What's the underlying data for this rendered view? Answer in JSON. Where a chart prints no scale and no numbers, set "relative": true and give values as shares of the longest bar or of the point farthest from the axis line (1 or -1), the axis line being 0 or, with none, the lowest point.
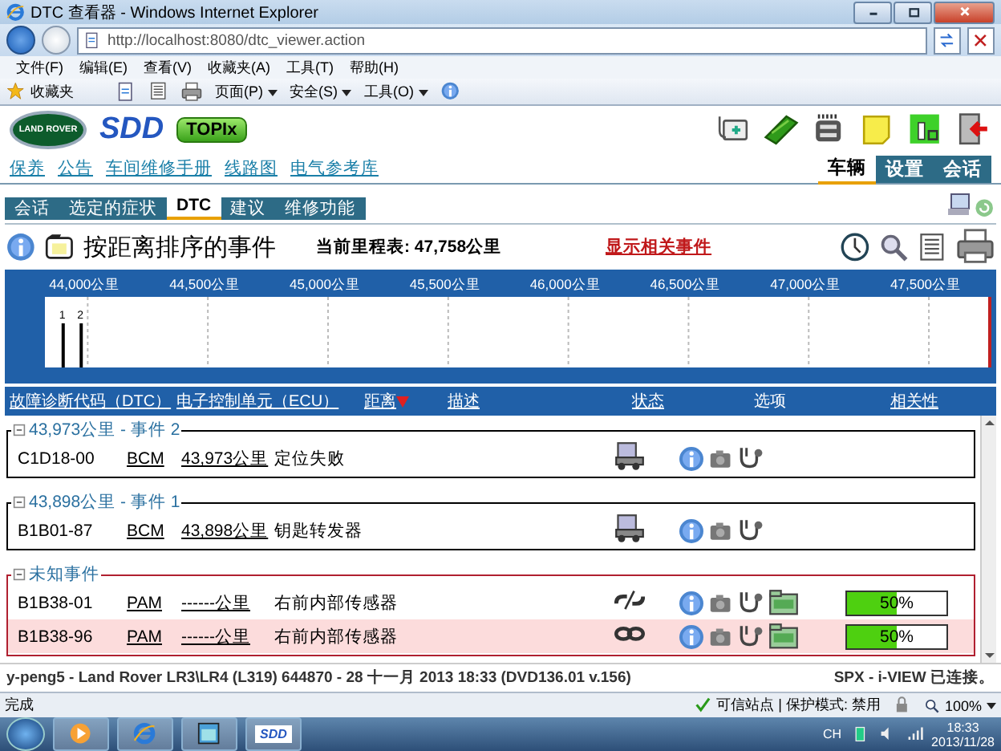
{
  "browser": {
    "title": "DTC 查看器 - Windows Internet Explorer",
    "address": "http://localhost:8080/dtc_viewer.action",
    "menu": [
      "文件(F)",
      "编辑(E)",
      "查看(V)",
      "收藏夹(A)",
      "工具(T)",
      "帮助(H)"
    ],
    "favorites": "收藏夹",
    "commands": [
      "页面(P)",
      "安全(S)",
      "工具(O)"
    ]
  },
  "header": {
    "logo": "LAND ROVER",
    "product": "SDD",
    "topix": "TOPIx",
    "links": [
      "保养",
      "公告",
      "车间维修手册",
      "线路图",
      "电气参考库"
    ],
    "top_tabs": [
      {
        "label": "车辆",
        "selected": true
      },
      {
        "label": "设置",
        "selected": false
      },
      {
        "label": "会话",
        "selected": false
      }
    ]
  },
  "tabs": [
    {
      "label": "会话",
      "selected": false
    },
    {
      "label": "选定的症状",
      "selected": false
    },
    {
      "label": "DTC",
      "selected": true
    },
    {
      "label": "建议",
      "selected": false
    },
    {
      "label": "维修功能",
      "selected": false
    }
  ],
  "title": "按距离排序的事件",
  "odometer_label": "当前里程表:",
  "odometer": "47,758公里",
  "related_link": "显示相关事件",
  "timeline": {
    "event_labels": [
      "1",
      "2"
    ],
    "chart_data": {
      "type": "bar",
      "x": [
        43898,
        43973
      ],
      "values": [
        1,
        1
      ],
      "relative": true,
      "grid": true,
      "xlim": [
        43822,
        47760
      ],
      "xticks": [
        {
          "value": 44000,
          "label": "44,000公里"
        },
        {
          "value": 44500,
          "label": "44,500公里"
        },
        {
          "value": 45000,
          "label": "45,000公里"
        },
        {
          "value": 45500,
          "label": "45,500公里"
        },
        {
          "value": 46000,
          "label": "46,000公里"
        },
        {
          "value": 46500,
          "label": "46,500公里"
        },
        {
          "value": 47000,
          "label": "47,000公里"
        },
        {
          "value": 47500,
          "label": "47,500公里"
        }
      ]
    }
  },
  "columns": [
    {
      "label": "故障诊断代码（DTC）",
      "link": true,
      "sorted": false
    },
    {
      "label": "电子控制单元（ECU）",
      "link": true,
      "sorted": false
    },
    {
      "label": "距离",
      "link": true,
      "sorted": true
    },
    {
      "label": "描述",
      "link": true,
      "sorted": false
    },
    {
      "label": "状态",
      "link": true,
      "sorted": false
    },
    {
      "label": "选项",
      "link": false,
      "sorted": false
    },
    {
      "label": "相关性",
      "link": true,
      "sorted": false
    }
  ],
  "groups": [
    {
      "title": "43,973公里 - 事件 2",
      "kind": "event",
      "expanded": true,
      "rows": [
        {
          "dtc": "C1D18-00",
          "ecu": "BCM",
          "distance": "43,973公里",
          "description": "定位失败",
          "kind": "vehicle",
          "highlighted": false,
          "data": false
        }
      ]
    },
    {
      "title": "43,898公里 - 事件 1",
      "kind": "event",
      "expanded": true,
      "rows": [
        {
          "dtc": "B1B01-87",
          "ecu": "BCM",
          "distance": "43,898公里",
          "description": "钥匙转发器",
          "kind": "vehicle",
          "highlighted": false,
          "data": false
        }
      ]
    },
    {
      "title": "未知事件",
      "kind": "unknown",
      "expanded": true,
      "rows": [
        {
          "dtc": "B1B38-01",
          "ecu": "PAM",
          "distance": "------公里",
          "description": "右前内部传感器",
          "kind": "broken-link",
          "highlighted": false,
          "data": true,
          "level": 0.5,
          "reading": "50%"
        },
        {
          "dtc": "B1B38-96",
          "ecu": "PAM",
          "distance": "------公里",
          "description": "右前内部传感器",
          "kind": "link",
          "highlighted": true,
          "data": true,
          "level": 0.5,
          "reading": "50%"
        }
      ]
    }
  ],
  "status_line": {
    "left": "y-peng5 - Land Rover LR3\\LR4 (L319) 644870 - 28 十一月 2013 18:33 (DVD136.01 v.156)",
    "right": "SPX - i-VIEW 已连接。"
  },
  "ie_status": {
    "left": "完成",
    "zone": "可信站点 | 保护模式: 禁用",
    "zoom": "100%"
  },
  "taskbar": {
    "buttons": [
      {
        "kind": "media"
      },
      {
        "kind": "ie"
      },
      {
        "kind": "app"
      },
      {
        "kind": "sdd",
        "label": "SDD"
      }
    ],
    "lang": "CH",
    "time": "18:33",
    "date": "2013/11/28"
  }
}
